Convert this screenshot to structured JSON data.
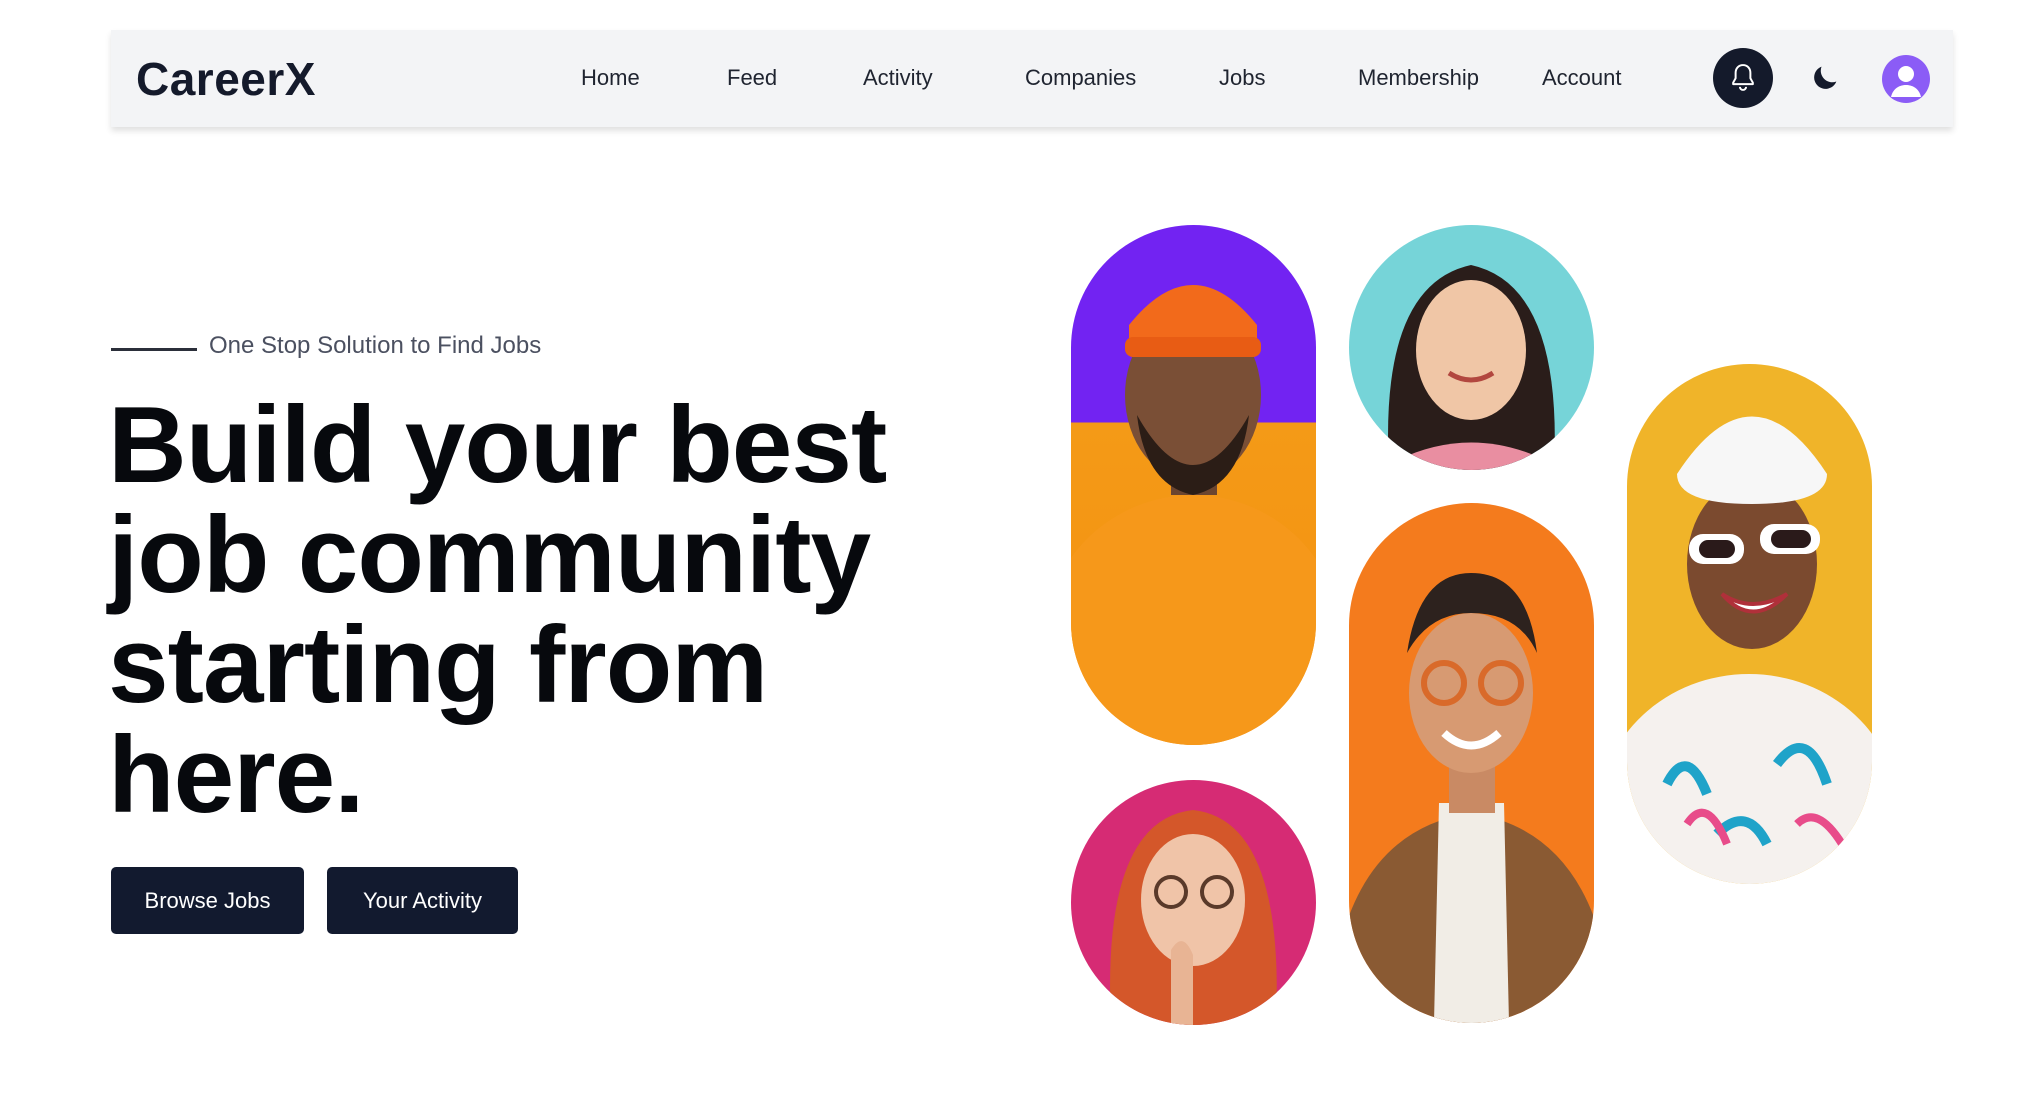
{
  "app": {
    "brand": "CareerX"
  },
  "nav": {
    "links": [
      "Home",
      "Feed",
      "Activity",
      "Companies",
      "Jobs",
      "Membership",
      "Account"
    ]
  },
  "hero": {
    "tagline": "One Stop Solution to Find Jobs",
    "title_lines": [
      "Build your best",
      "job community",
      "starting from",
      "here."
    ],
    "buttons": {
      "browse": "Browse Jobs",
      "activity": "Your Activity"
    }
  },
  "icons": {
    "notifications": "bell-icon",
    "theme": "moon-icon",
    "profile": "user-avatar-icon"
  },
  "colors": {
    "primary": "#121a2f",
    "navbar_bg": "#f3f4f6",
    "avatar": "#8b5cf6",
    "pill_purple": "#7223f2",
    "pill_teal": "#76d4d8",
    "pill_yellow": "#f0b429",
    "pill_orange": "#f47b1d",
    "pill_pink": "#d62b74"
  }
}
